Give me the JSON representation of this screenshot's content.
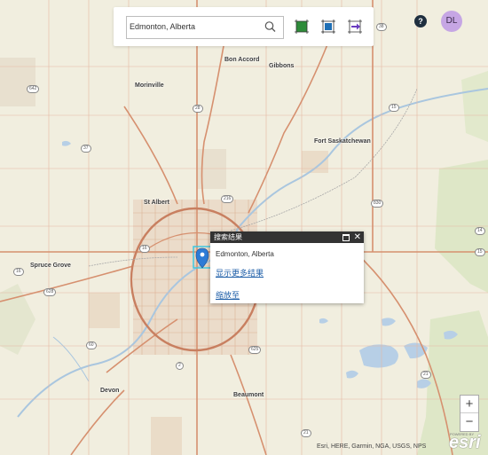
{
  "search": {
    "value": "Edmonton, Alberta"
  },
  "toolbar": {
    "tools": [
      {
        "name": "select-extent-icon",
        "color": "#2e8b3a"
      },
      {
        "name": "zoom-box-icon",
        "color": "#1f6fb5"
      },
      {
        "name": "measure-arrow-icon",
        "color": "#6a3cc0"
      }
    ]
  },
  "help": {
    "label": "?"
  },
  "user": {
    "initials": "DL",
    "color": "#c6a6e4"
  },
  "popup": {
    "header": "搜索结果",
    "title": "Edmonton, Alberta",
    "more_results": "显示更多结果",
    "zoom_to": "缩放至"
  },
  "zoom": {
    "plus": "+",
    "minus": "−"
  },
  "attribution": "Esri, HERE, Garmin, NGA, USGS, NPS",
  "logo": {
    "text": "esri",
    "powered": "POWERED BY"
  },
  "places": {
    "bon_accord": "Bon Accord",
    "gibbons": "Gibbons",
    "morinville": "Morinville",
    "fort_sask": "Fort Saskatchewan",
    "st_albert": "St Albert",
    "spruce_grove": "Spruce Grove",
    "devon": "Devon",
    "beaumont": "Beaumont"
  },
  "shields": [
    "642",
    "28",
    "37",
    "38",
    "15",
    "216",
    "830",
    "16",
    "16",
    "628",
    "15",
    "60",
    "2",
    "21",
    "625",
    "21",
    "14"
  ],
  "colors": {
    "accent": "#1f5fa8",
    "marker": "#2d7bd6",
    "highlight": "#3ec6e0"
  }
}
